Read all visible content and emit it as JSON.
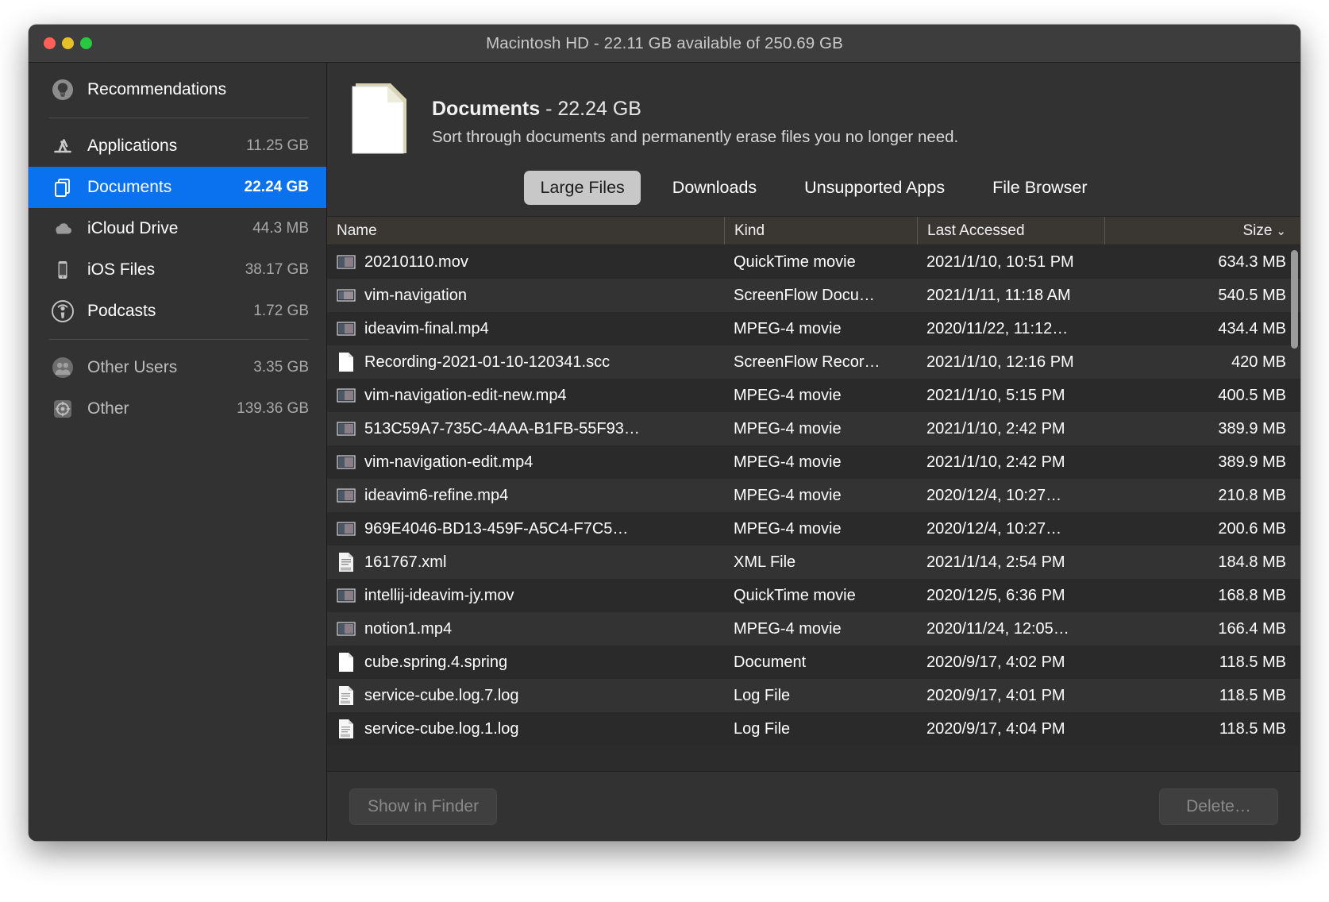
{
  "window": {
    "title": "Macintosh HD - 22.11 GB available of 250.69 GB",
    "traffic": {
      "close": "close-button",
      "minimize": "minimize-button",
      "maximize": "maximize-button"
    },
    "accent_color": "#0a72ef",
    "background_color": "#323232"
  },
  "sidebar": {
    "items": [
      {
        "label": "Recommendations",
        "size": "",
        "icon": "lightbulb-icon",
        "selected": false,
        "dim": false
      },
      {
        "label": "Applications",
        "size": "11.25 GB",
        "icon": "app-store-icon",
        "selected": false,
        "dim": false
      },
      {
        "label": "Documents",
        "size": "22.24 GB",
        "icon": "documents-icon",
        "selected": true,
        "dim": false
      },
      {
        "label": "iCloud Drive",
        "size": "44.3 MB",
        "icon": "cloud-icon",
        "selected": false,
        "dim": false
      },
      {
        "label": "iOS Files",
        "size": "38.17 GB",
        "icon": "iphone-icon",
        "selected": false,
        "dim": false
      },
      {
        "label": "Podcasts",
        "size": "1.72 GB",
        "icon": "podcast-icon",
        "selected": false,
        "dim": false
      },
      {
        "label": "Other Users",
        "size": "3.35 GB",
        "icon": "users-icon",
        "selected": false,
        "dim": true
      },
      {
        "label": "Other",
        "size": "139.36 GB",
        "icon": "gear-disc-icon",
        "selected": false,
        "dim": true
      }
    ]
  },
  "header": {
    "icon": "document-file-icon",
    "title": "Documents",
    "size": " - 22.24 GB",
    "subtitle": "Sort through documents and permanently erase files you no longer need."
  },
  "tabs": [
    {
      "label": "Large Files",
      "active": true
    },
    {
      "label": "Downloads",
      "active": false
    },
    {
      "label": "Unsupported Apps",
      "active": false
    },
    {
      "label": "File Browser",
      "active": false
    }
  ],
  "table": {
    "columns": [
      {
        "key": "name",
        "label": "Name"
      },
      {
        "key": "kind",
        "label": "Kind"
      },
      {
        "key": "date",
        "label": "Last Accessed"
      },
      {
        "key": "size",
        "label": "Size"
      }
    ],
    "sort": {
      "column": "Size",
      "direction": "descending",
      "chevron": "⌄"
    },
    "rows": [
      {
        "name": "20210110.mov",
        "kind": "QuickTime movie",
        "date": "2021/1/10, 10:51 PM",
        "size": "634.3 MB",
        "icon": "movie-thumbnail-icon"
      },
      {
        "name": "vim-navigation",
        "kind": "ScreenFlow Docu…",
        "date": "2021/1/11, 11:18 AM",
        "size": "540.5 MB",
        "icon": "screenflow-thumbnail-icon"
      },
      {
        "name": "ideavim-final.mp4",
        "kind": "MPEG-4 movie",
        "date": "2020/11/22, 11:12…",
        "size": "434.4 MB",
        "icon": "movie-thumbnail-icon"
      },
      {
        "name": "Recording-2021-01-10-120341.scc",
        "kind": "ScreenFlow Recor…",
        "date": "2021/1/10, 12:16 PM",
        "size": "420 MB",
        "icon": "blank-document-icon"
      },
      {
        "name": "vim-navigation-edit-new.mp4",
        "kind": "MPEG-4 movie",
        "date": "2021/1/10, 5:15 PM",
        "size": "400.5 MB",
        "icon": "movie-thumbnail-icon"
      },
      {
        "name": "513C59A7-735C-4AAA-B1FB-55F93…",
        "kind": "MPEG-4 movie",
        "date": "2021/1/10, 2:42 PM",
        "size": "389.9 MB",
        "icon": "movie-thumbnail-icon"
      },
      {
        "name": "vim-navigation-edit.mp4",
        "kind": "MPEG-4 movie",
        "date": "2021/1/10, 2:42 PM",
        "size": "389.9 MB",
        "icon": "movie-thumbnail-icon"
      },
      {
        "name": "ideavim6-refine.mp4",
        "kind": "MPEG-4 movie",
        "date": "2020/12/4, 10:27…",
        "size": "210.8 MB",
        "icon": "movie-thumbnail-icon"
      },
      {
        "name": "969E4046-BD13-459F-A5C4-F7C5…",
        "kind": "MPEG-4 movie",
        "date": "2020/12/4, 10:27…",
        "size": "200.6 MB",
        "icon": "movie-thumbnail-icon"
      },
      {
        "name": "161767.xml",
        "kind": "XML File",
        "date": "2021/1/14, 2:54 PM",
        "size": "184.8 MB",
        "icon": "xml-document-icon"
      },
      {
        "name": "intellij-ideavim-jy.mov",
        "kind": "QuickTime movie",
        "date": "2020/12/5, 6:36 PM",
        "size": "168.8 MB",
        "icon": "movie-thumbnail-icon"
      },
      {
        "name": "notion1.mp4",
        "kind": "MPEG-4 movie",
        "date": "2020/11/24, 12:05…",
        "size": "166.4 MB",
        "icon": "movie-thumbnail-icon"
      },
      {
        "name": "cube.spring.4.spring",
        "kind": "Document",
        "date": "2020/9/17, 4:02 PM",
        "size": "118.5 MB",
        "icon": "blank-document-icon"
      },
      {
        "name": "service-cube.log.7.log",
        "kind": "Log File",
        "date": "2020/9/17, 4:01 PM",
        "size": "118.5 MB",
        "icon": "log-document-icon"
      },
      {
        "name": "service-cube.log.1.log",
        "kind": "Log File",
        "date": "2020/9/17, 4:04 PM",
        "size": "118.5 MB",
        "icon": "log-document-icon"
      }
    ]
  },
  "footer": {
    "show_in_finder": "Show in Finder",
    "delete": "Delete…"
  }
}
